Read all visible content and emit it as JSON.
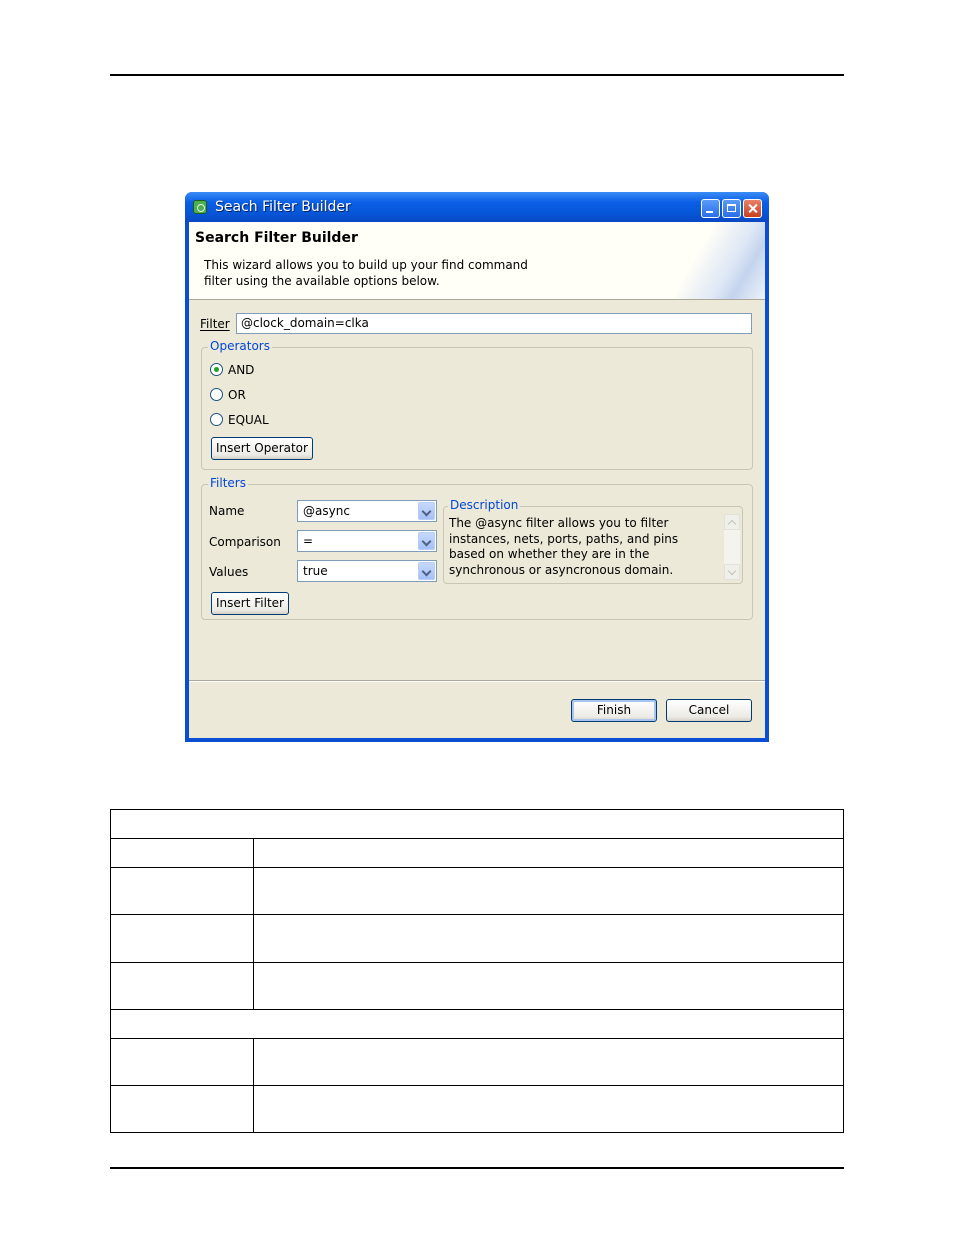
{
  "window": {
    "title": "Seach Filter Builder",
    "banner_title": "Search Filter Builder",
    "banner_description": "This wizard allows you to build up your find command filter using the available options below."
  },
  "filter": {
    "label": "Filter",
    "value": "@clock_domain=clka"
  },
  "operators": {
    "group_title": "Operators",
    "options": [
      {
        "label": "AND",
        "selected": true
      },
      {
        "label": "OR",
        "selected": false
      },
      {
        "label": "EQUAL",
        "selected": false
      }
    ],
    "insert_button": "Insert Operator"
  },
  "filters": {
    "group_title": "Filters",
    "name": {
      "label": "Name",
      "value": "@async"
    },
    "comparison": {
      "label": "Comparison",
      "value": "="
    },
    "values": {
      "label": "Values",
      "value": "true"
    },
    "insert_button": "Insert Filter",
    "description": {
      "title": "Description",
      "text": "The @async filter allows you to filter instances, nets, ports, paths, and pins based on whether they are in the synchronous or asyncronous domain."
    }
  },
  "buttons": {
    "finish": "Finish",
    "cancel": "Cancel"
  }
}
